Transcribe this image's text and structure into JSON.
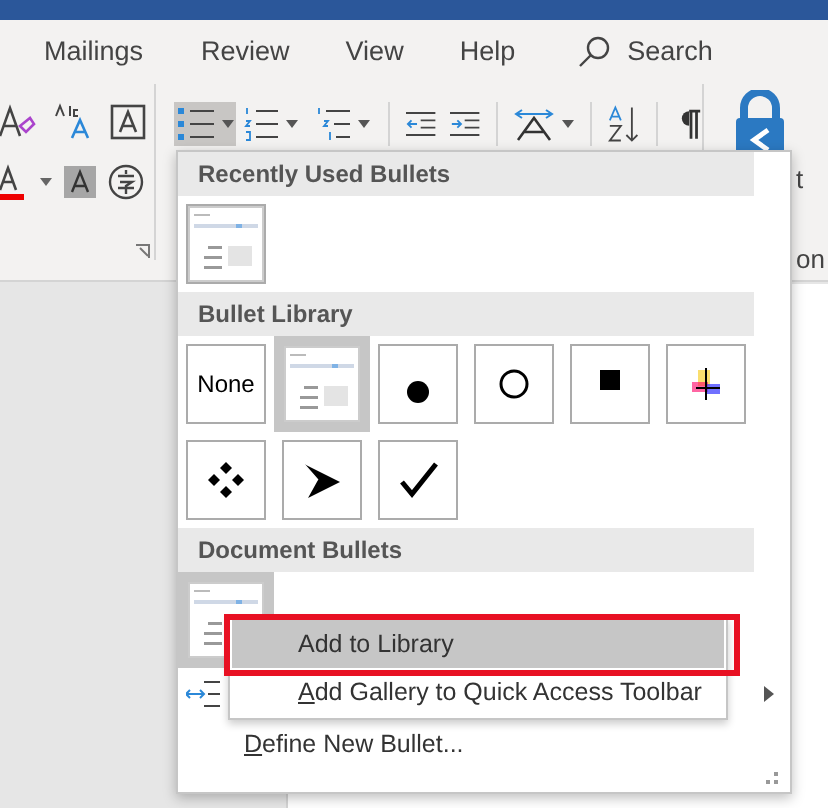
{
  "tabs": [
    {
      "label": "Mailings"
    },
    {
      "label": "Review"
    },
    {
      "label": "View"
    },
    {
      "label": "Help"
    }
  ],
  "search": {
    "label": "Search"
  },
  "ribbon": {
    "bullets_pressed": true,
    "cut_labels": [
      "t",
      "on"
    ]
  },
  "bullet_menu": {
    "sections": [
      {
        "title": "Recently Used Bullets",
        "items": [
          {
            "kind": "thumbnail",
            "selected": false
          }
        ]
      },
      {
        "title": "Bullet Library",
        "items": [
          {
            "kind": "none",
            "label": "None",
            "selected": false
          },
          {
            "kind": "thumbnail",
            "selected": true
          },
          {
            "kind": "disc",
            "selected": false
          },
          {
            "kind": "ring",
            "selected": false
          },
          {
            "kind": "square",
            "selected": false
          },
          {
            "kind": "cross",
            "selected": false
          },
          {
            "kind": "diamonds",
            "selected": false
          },
          {
            "kind": "arrowhead",
            "selected": false
          },
          {
            "kind": "check",
            "selected": false
          }
        ]
      },
      {
        "title": "Document Bullets",
        "items": [
          {
            "kind": "thumbnail",
            "selected": true
          }
        ]
      }
    ],
    "commands": [
      {
        "kind": "submenu"
      },
      {
        "kind": "define",
        "label": "Define New Bullet...",
        "underline_first": true
      }
    ]
  },
  "context_menu": {
    "items": [
      {
        "label": "Add to Library",
        "selected": true,
        "outlined": true,
        "underline_first": false
      },
      {
        "label": "Add Gallery to Quick Access Toolbar",
        "selected": false,
        "outlined": false,
        "underline_first": true
      }
    ]
  }
}
